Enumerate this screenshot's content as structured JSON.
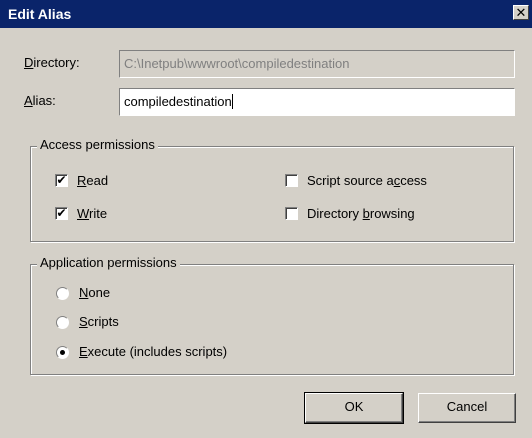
{
  "window": {
    "title": "Edit Alias",
    "close_glyph": "✕"
  },
  "directory": {
    "label_pre": "",
    "label_u": "D",
    "label_post": "irectory:",
    "value": "C:\\Inetpub\\wwwroot\\compiledestination"
  },
  "alias": {
    "label_pre": "",
    "label_u": "A",
    "label_post": "lias:",
    "value": "compiledestination"
  },
  "access": {
    "legend": "Access permissions",
    "read": {
      "checked": true,
      "label_pre": "",
      "label_u": "R",
      "label_post": "ead"
    },
    "write": {
      "checked": true,
      "label_pre": "",
      "label_u": "W",
      "label_post": "rite"
    },
    "script_source": {
      "checked": false,
      "label_pre": "Script source a",
      "label_u": "c",
      "label_post": "cess"
    },
    "dir_browsing": {
      "checked": false,
      "label_pre": "Directory ",
      "label_u": "b",
      "label_post": "rowsing"
    }
  },
  "app": {
    "legend": "Application permissions",
    "none": {
      "selected": false,
      "label_pre": "",
      "label_u": "N",
      "label_post": "one"
    },
    "scripts": {
      "selected": false,
      "label_pre": "",
      "label_u": "S",
      "label_post": "cripts"
    },
    "execute": {
      "selected": true,
      "label_pre": "",
      "label_u": "E",
      "label_post": "xecute (includes scripts)"
    }
  },
  "buttons": {
    "ok": "OK",
    "cancel": "Cancel"
  },
  "check_glyph": "✔"
}
